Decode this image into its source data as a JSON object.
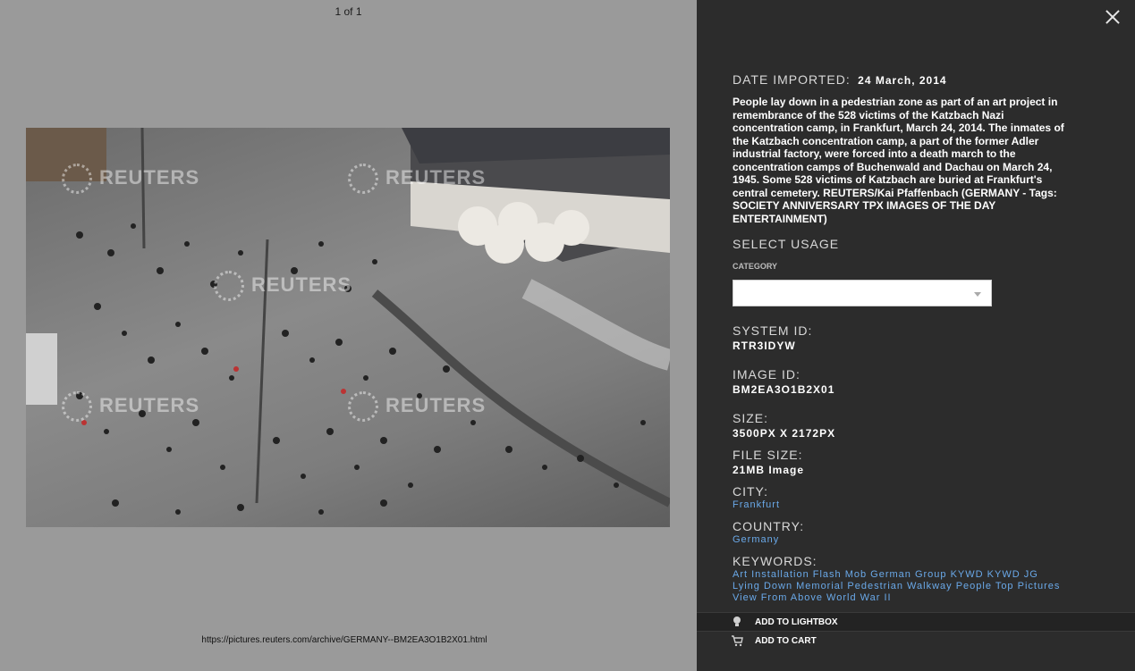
{
  "viewer": {
    "pager": "1 of 1",
    "watermark": "REUTERS",
    "source_url": "https://pictures.reuters.com/archive/GERMANY--BM2EA3O1B2X01.html"
  },
  "panel": {
    "date_label": "DATE IMPORTED:",
    "date_value": "24 March, 2014",
    "caption": "People lay down in a pedestrian zone as part of an art project in remembrance of the 528 victims of the Katzbach Nazi concentration camp, in Frankfurt, March 24, 2014. The inmates of the Katzbach concentration camp, a part of the former Adler industrial factory, were forced into a death march to the concentration camps of Buchenwald and Dachau on March 24, 1945. Some 528 victims of Katzbach are buried at Frankfurt's central cemetery. REUTERS/Kai Pfaffenbach (GERMANY - Tags: SOCIETY ANNIVERSARY TPX IMAGES OF THE DAY ENTERTAINMENT)",
    "select_usage": "SELECT USAGE",
    "category_label": "CATEGORY",
    "category_value": "",
    "system_id_label": "SYSTEM ID:",
    "system_id": "RTR3IDYW",
    "image_id_label": "IMAGE ID:",
    "image_id": "BM2EA3O1B2X01",
    "size_label": "SIZE:",
    "size": "3500PX X 2172PX",
    "file_size_label": "FILE SIZE:",
    "file_size": "21MB Image",
    "city_label": "CITY:",
    "city": "Frankfurt",
    "country_label": "COUNTRY:",
    "country": "Germany",
    "keywords_label": "KEYWORDS:",
    "keywords_line1": "Art Installation Flash Mob German Group KYWD KYWD JG",
    "keywords_line2": "Lying Down Memorial Pedestrian Walkway People Top Pictures",
    "keywords_line3": "View From Above World War II",
    "add_to_lightbox": "ADD TO LIGHTBOX",
    "add_to_cart": "ADD TO CART"
  },
  "icons": {
    "close": "close-icon",
    "lightbox": "lightbulb-icon",
    "cart": "cart-icon",
    "dropdown": "chevron-down-icon"
  }
}
